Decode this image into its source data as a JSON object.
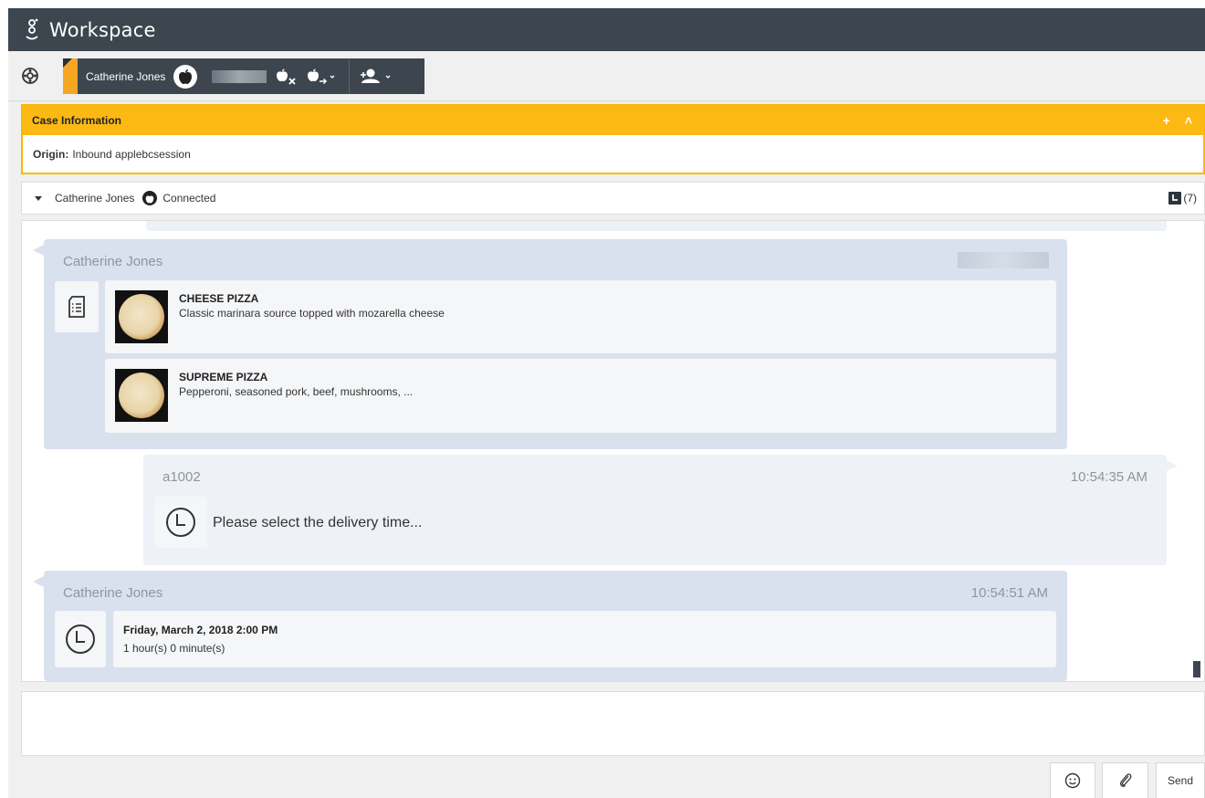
{
  "app": {
    "title": "Workspace"
  },
  "toolbar": {
    "party_name": "Catherine Jones",
    "icons": [
      "gear-icon",
      "apple-business-chat-icon",
      "apple-end-icon",
      "apple-transfer-icon",
      "add-party-icon"
    ]
  },
  "case": {
    "title": "Case Information",
    "add_symbol": "+",
    "collapse_symbol": "˄",
    "origin_label": "Origin:",
    "origin_value": "Inbound applebcsession"
  },
  "contact": {
    "name": "Catherine Jones",
    "status": "Connected",
    "history_count": "(7)"
  },
  "messages": [
    {
      "sender": "Catherine Jones",
      "time": "",
      "items": [
        {
          "title": "CHEESE PIZZA",
          "description": "Classic marinara source topped with mozarella cheese"
        },
        {
          "title": "SUPREME PIZZA",
          "description": "Pepperoni, seasoned pork, beef, mushrooms, ..."
        }
      ]
    },
    {
      "sender": "a1002",
      "time": "10:54:35 AM",
      "text": "Please select the delivery time..."
    },
    {
      "sender": "Catherine Jones",
      "time": "10:54:51 AM",
      "line1": "Friday, March 2, 2018 2:00 PM",
      "line2": "1 hour(s) 0 minute(s)"
    }
  ],
  "compose": {
    "send_label": "Send"
  },
  "colors": {
    "titlebar": "#3d464f",
    "case_header": "#fdb913",
    "inbound_bubble": "#d9e1ee",
    "outbound_bubble": "#eef2f7"
  }
}
